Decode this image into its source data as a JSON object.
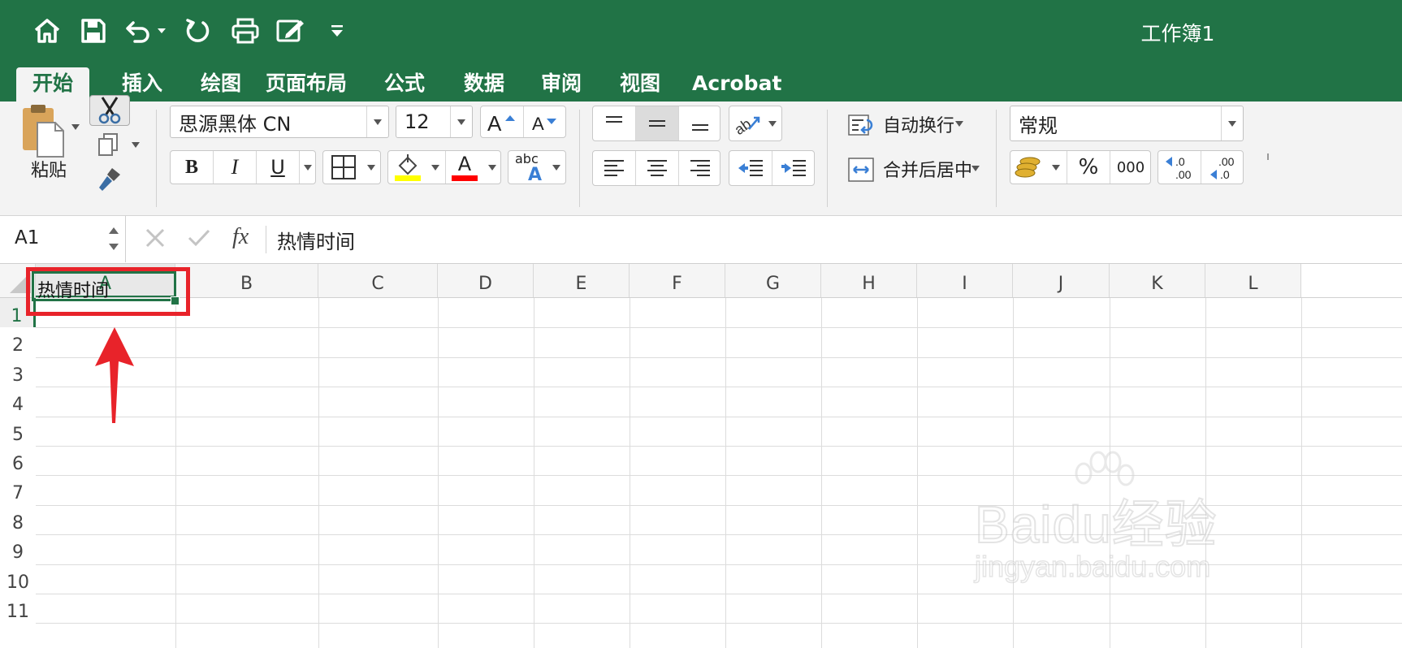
{
  "app": {
    "title": "工作簿1",
    "accent_color": "#217346"
  },
  "quick_access": [
    "home-icon",
    "save-icon",
    "undo-icon",
    "redo-icon",
    "print-icon",
    "edit-icon",
    "customize-icon"
  ],
  "tabs": [
    {
      "label": "开始",
      "active": true
    },
    {
      "label": "插入"
    },
    {
      "label": "绘图"
    },
    {
      "label": "页面布局"
    },
    {
      "label": "公式"
    },
    {
      "label": "数据"
    },
    {
      "label": "审阅"
    },
    {
      "label": "视图"
    },
    {
      "label": "Acrobat"
    }
  ],
  "ribbon": {
    "paste_label": "粘贴",
    "font_name": "思源黑体 CN",
    "font_size": "12",
    "bold": "B",
    "italic": "I",
    "underline": "U",
    "font_color_letter": "A",
    "phonetic_top": "abc",
    "phonetic_bottom": "A",
    "wrap_text": "自动换行",
    "merge_center": "合并后居中",
    "number_format": "常规",
    "percent": "%",
    "thousands": "000",
    "fill_color": "#ffff00",
    "font_color": "#ff0000"
  },
  "formula_bar": {
    "name_box": "A1",
    "fx": "fx",
    "content": "热情时间"
  },
  "sheet": {
    "columns": [
      "A",
      "B",
      "C",
      "D",
      "E",
      "F",
      "G",
      "H",
      "I",
      "J",
      "K",
      "L"
    ],
    "rows": [
      "1",
      "2",
      "3",
      "4",
      "5",
      "6",
      "7",
      "8",
      "9",
      "10",
      "11"
    ],
    "cells": {
      "A1": "热情时间"
    },
    "active_cell": "A1"
  },
  "watermark": {
    "brand": "Baidu经验",
    "url": "jingyan.baidu.com"
  }
}
